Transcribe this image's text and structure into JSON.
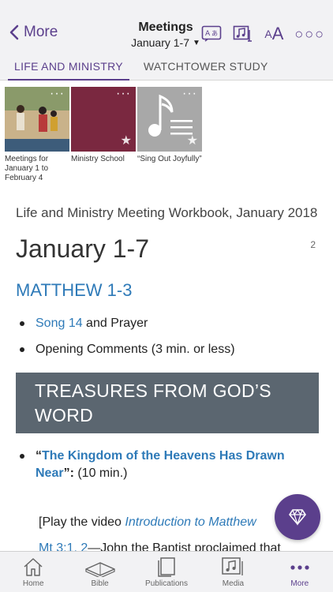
{
  "nav": {
    "back_label": "More",
    "title": "Meetings",
    "subtitle": "January 1-7"
  },
  "tabs": [
    {
      "label": "LIFE AND MINISTRY",
      "active": true
    },
    {
      "label": "WATCHTOWER STUDY",
      "active": false
    }
  ],
  "media": [
    {
      "caption": "Meetings for January 1 to February 4",
      "color": "#6b8a9a"
    },
    {
      "caption": "Ministry School",
      "color": "#7a2840"
    },
    {
      "caption": "“Sing Out Joyfully”",
      "color": "#a8a8a8"
    }
  ],
  "article": {
    "publication_title": "Life and Ministry Meeting Workbook, January 2018",
    "week": "January 1-7",
    "page_number": "2",
    "bible_reading": "MATTHEW 1-3",
    "items": [
      {
        "link": "Song 14",
        "text": " and Prayer"
      },
      {
        "text": "Opening Comments (3 min. or less)"
      }
    ],
    "section_heading": "TREASURES FROM GOD’S WORD",
    "talk": {
      "open_quote": "“",
      "link": "The Kingdom of the Heavens Has Drawn Near",
      "close": "”:",
      "duration": " (10 min.)"
    },
    "sub_line1_prefix": "[Play the video ",
    "sub_line1_link": "Introduction to Matthew",
    "sub_line2_link": "Mt 3:1, 2",
    "sub_line2_text": "—John the Baptist proclaimed that"
  },
  "tabbar": [
    {
      "label": "Home",
      "icon": "home-icon",
      "active": false
    },
    {
      "label": "Bible",
      "icon": "bible-icon",
      "active": false
    },
    {
      "label": "Publications",
      "icon": "publications-icon",
      "active": false
    },
    {
      "label": "Media",
      "icon": "media-icon",
      "active": false
    },
    {
      "label": "More",
      "icon": "more-icon",
      "active": true
    }
  ],
  "colors": {
    "accent": "#5b3f8c",
    "link": "#2e7ab8",
    "banner": "#5b6670"
  }
}
